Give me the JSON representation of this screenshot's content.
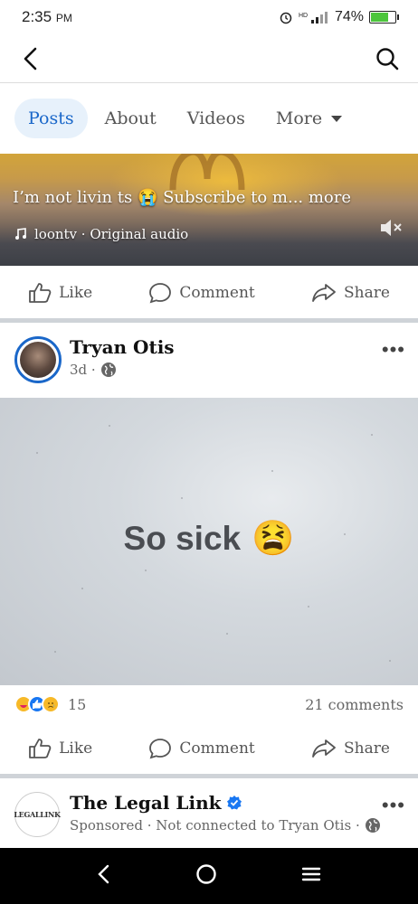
{
  "status_bar": {
    "time": "2:35",
    "ampm": "PM",
    "battery": "74%",
    "battery_level": 0.74
  },
  "tabs": [
    {
      "label": "Posts",
      "active": true
    },
    {
      "label": "About",
      "active": false
    },
    {
      "label": "Videos",
      "active": false
    },
    {
      "label": "More",
      "active": false
    }
  ],
  "reel": {
    "caption": "I’m not livin ts 😭 Subscribe to m... more",
    "audio": "loontv · Original audio"
  },
  "actions": {
    "like": "Like",
    "comment": "Comment",
    "share": "Share"
  },
  "post": {
    "author": "Tryan Otis",
    "time": "3d ·",
    "text": "So sick",
    "emoji": "😫",
    "reaction_count": "15",
    "comments": "21 comments"
  },
  "sponsored": {
    "name": "The Legal Link",
    "logo_text": "LEGALLINK",
    "meta": "Sponsored · Not connected to Tryan Otis ·"
  },
  "colors": {
    "accent": "#1a67c9",
    "active_tab_bg": "#e7f1fb",
    "battery": "#4cc53c"
  }
}
